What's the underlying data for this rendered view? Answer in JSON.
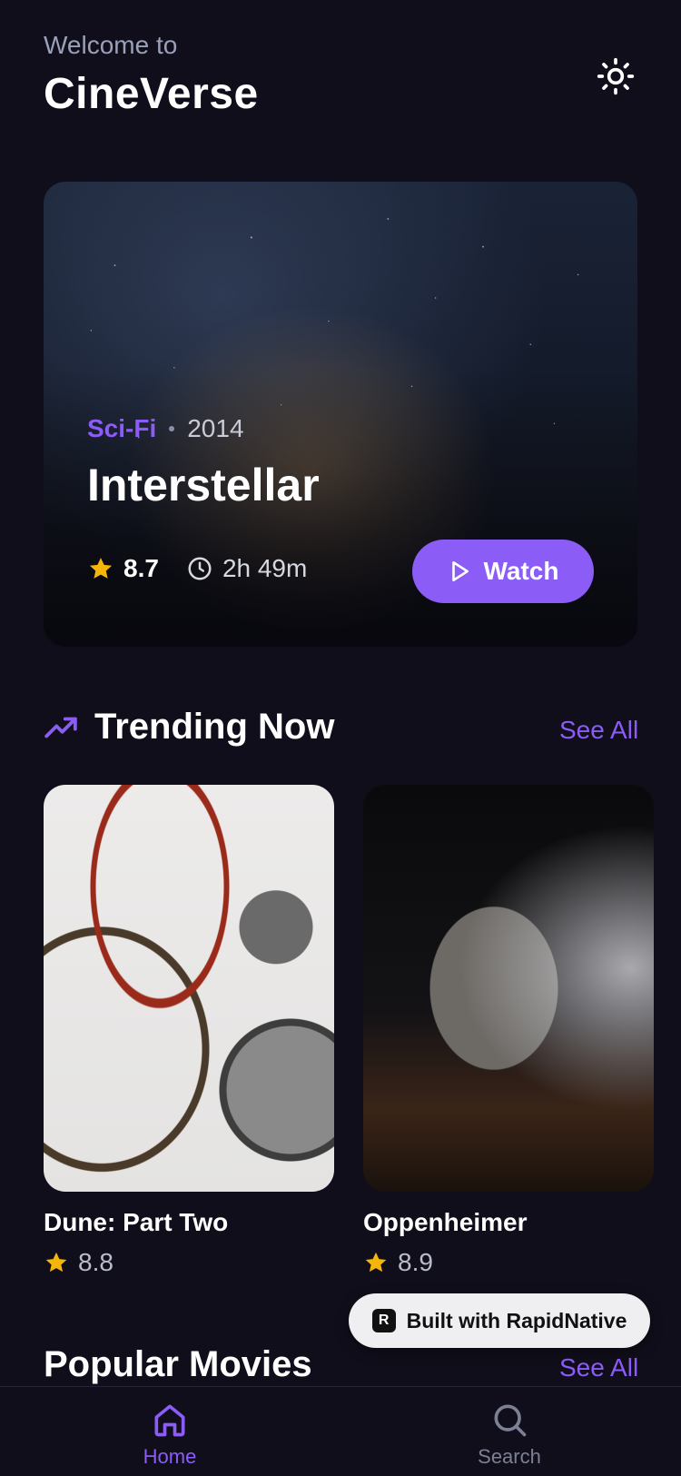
{
  "header": {
    "welcome": "Welcome to",
    "brand": "CineVerse",
    "theme_icon": "sun-icon"
  },
  "hero": {
    "genre": "Sci-Fi",
    "year": "2014",
    "title": "Interstellar",
    "rating": "8.7",
    "runtime": "2h 49m",
    "watch_label": "Watch"
  },
  "trending": {
    "title": "Trending Now",
    "see_all": "See All",
    "movies": [
      {
        "title": "Dune: Part Two",
        "rating": "8.8"
      },
      {
        "title": "Oppenheimer",
        "rating": "8.9"
      }
    ]
  },
  "popular": {
    "title": "Popular Movies",
    "see_all": "See All"
  },
  "badge": {
    "label": "Built with RapidNative",
    "logo_letter": "R"
  },
  "nav": {
    "home": "Home",
    "search": "Search"
  },
  "colors": {
    "background": "#0f0e1a",
    "accent": "#8b5cf6",
    "star": "#f5b50a",
    "muted": "#9aa0b8"
  }
}
